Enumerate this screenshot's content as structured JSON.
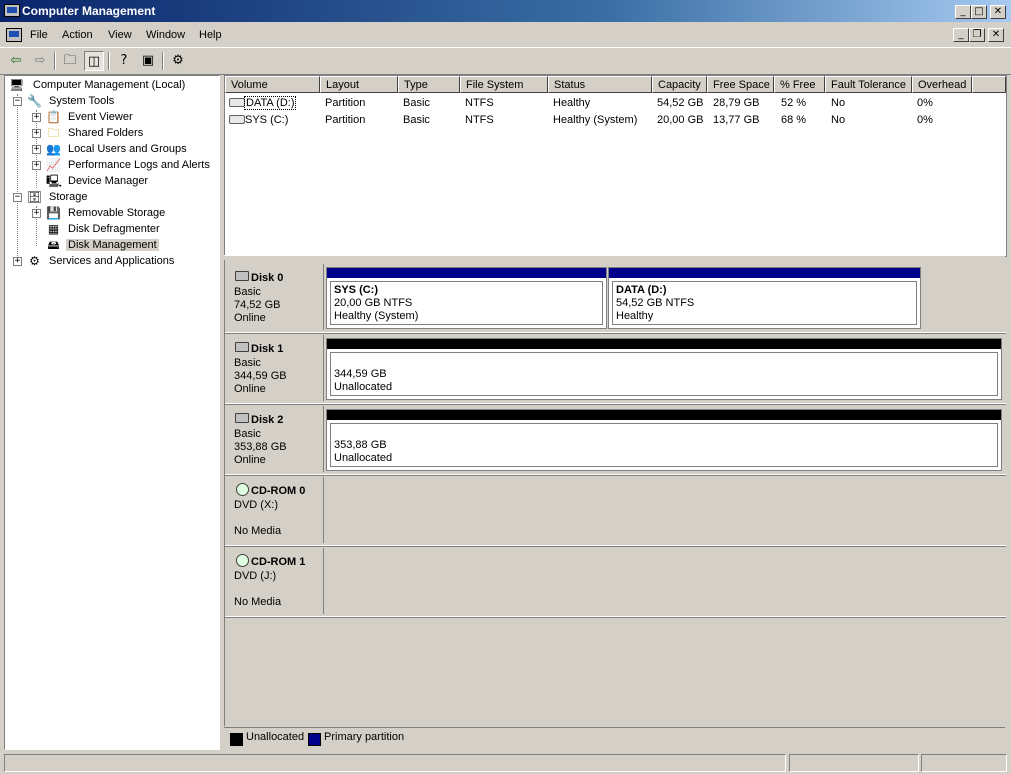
{
  "window": {
    "title": "Computer Management"
  },
  "caption_buttons": {
    "minimize": "_",
    "maximize": "□",
    "close": "✕",
    "restore": "❐"
  },
  "menu": [
    {
      "label": "File"
    },
    {
      "label": "Action"
    },
    {
      "label": "View"
    },
    {
      "label": "Window"
    },
    {
      "label": "Help"
    }
  ],
  "toolbar": {
    "icons": [
      "back-arrow-icon",
      "forward-arrow-icon",
      "up-folder-icon",
      "show-hide-tree-icon",
      "help-icon",
      "console-icon",
      "properties-icon"
    ]
  },
  "tree": {
    "root": "Computer Management (Local)",
    "system_tools": "System Tools",
    "event_viewer": "Event Viewer",
    "shared_folders": "Shared Folders",
    "local_users": "Local Users and Groups",
    "perf_logs": "Performance Logs and Alerts",
    "device_manager": "Device Manager",
    "storage": "Storage",
    "removable_storage": "Removable Storage",
    "disk_defrag": "Disk Defragmenter",
    "disk_management": "Disk Management",
    "services_apps": "Services and Applications",
    "expand_plus": "+",
    "expand_minus": "−"
  },
  "volume_list": {
    "columns": [
      "Volume",
      "Layout",
      "Type",
      "File System",
      "Status",
      "Capacity",
      "Free Space",
      "% Free",
      "Fault Tolerance",
      "Overhead"
    ],
    "rows": [
      [
        "DATA (D:)",
        "Partition",
        "Basic",
        "NTFS",
        "Healthy",
        "54,52 GB",
        "28,79 GB",
        "52 %",
        "No",
        "0%"
      ],
      [
        "SYS (C:)",
        "Partition",
        "Basic",
        "NTFS",
        "Healthy (System)",
        "20,00 GB",
        "13,77 GB",
        "68 %",
        "No",
        "0%"
      ]
    ]
  },
  "disks": [
    {
      "name": "Disk 0",
      "type": "Basic",
      "size": "74,52 GB",
      "state": "Online",
      "partitions": [
        {
          "label": "SYS  (C:)",
          "line2": "20,00 GB NTFS",
          "line3": "Healthy (System)"
        },
        {
          "label": "DATA  (D:)",
          "line2": "54,52 GB NTFS",
          "line3": "Healthy"
        }
      ]
    },
    {
      "name": "Disk 1",
      "type": "Basic",
      "size": "344,59 GB",
      "state": "Online",
      "partitions": [
        {
          "line2": "344,59 GB",
          "line3": "Unallocated"
        }
      ]
    },
    {
      "name": "Disk 2",
      "type": "Basic",
      "size": "353,88 GB",
      "state": "Online",
      "partitions": [
        {
          "line2": "353,88 GB",
          "line3": "Unallocated"
        }
      ]
    },
    {
      "name": "CD-ROM 0",
      "type": "DVD (X:)",
      "state": "No Media"
    },
    {
      "name": "CD-ROM 1",
      "type": "DVD (J:)",
      "state": "No Media"
    }
  ],
  "legend": {
    "unallocated": "Unallocated",
    "primary": "Primary partition"
  },
  "colors": {
    "primary_partition": "#00008b",
    "unallocated": "#000000",
    "title_start": "#0a246a",
    "title_end": "#a6caf0"
  }
}
